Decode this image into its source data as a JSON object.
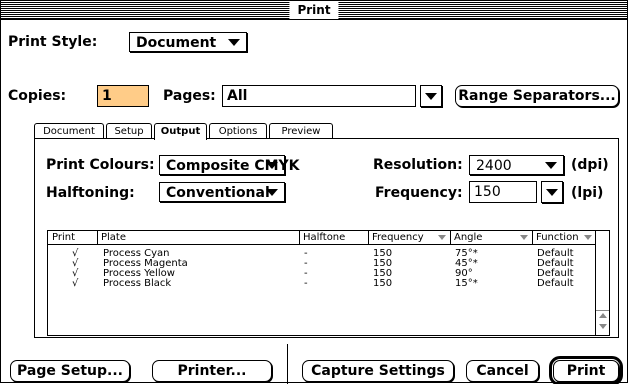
{
  "window": {
    "title": "Print"
  },
  "print_style": {
    "label": "Print Style:",
    "value": "Document"
  },
  "copies": {
    "label": "Copies:",
    "value": "1"
  },
  "pages": {
    "label": "Pages:",
    "value": "All"
  },
  "buttons": {
    "range_separators": "Range Separators...",
    "page_setup": "Page Setup...",
    "printer": "Printer...",
    "capture_settings": "Capture Settings",
    "cancel": "Cancel",
    "print": "Print"
  },
  "tabs": [
    "Document",
    "Setup",
    "Output",
    "Options",
    "Preview"
  ],
  "active_tab": "Output",
  "output": {
    "print_colours": {
      "label": "Print Colours:",
      "value": "Composite CMYK"
    },
    "halftoning": {
      "label": "Halftoning:",
      "value": "Conventional"
    },
    "resolution": {
      "label": "Resolution:",
      "value": "2400",
      "unit": "(dpi)"
    },
    "frequency": {
      "label": "Frequency:",
      "value": "150",
      "unit": "(lpi)"
    }
  },
  "table": {
    "headers": [
      "Print",
      "Plate",
      "Halftone",
      "Frequency",
      "Angle",
      "Function"
    ],
    "rows": [
      {
        "print": "√",
        "plate": "Process Cyan",
        "halftone": "-",
        "frequency": "150",
        "angle": "75°*",
        "function": "Default"
      },
      {
        "print": "√",
        "plate": "Process Magenta",
        "halftone": "-",
        "frequency": "150",
        "angle": "45°*",
        "function": "Default"
      },
      {
        "print": "√",
        "plate": "Process Yellow",
        "halftone": "-",
        "frequency": "150",
        "angle": "90°",
        "function": "Default"
      },
      {
        "print": "√",
        "plate": "Process Black",
        "halftone": "-",
        "frequency": "150",
        "angle": "15°*",
        "function": "Default"
      }
    ]
  },
  "colors": {
    "copies_highlight": "#ffcc88"
  }
}
